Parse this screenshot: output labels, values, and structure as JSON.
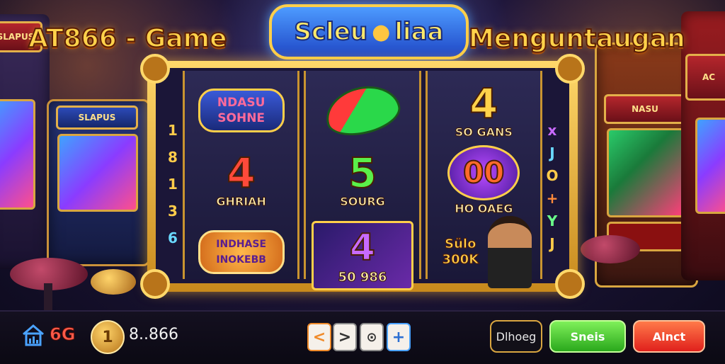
{
  "title": {
    "left": "AT866 - Game",
    "logo_left": "Scleu",
    "logo_right": "liaa",
    "right": "Menguntaugan"
  },
  "side_left_numbers": [
    "1",
    "8",
    "1",
    "3",
    "6"
  ],
  "side_right_symbols": [
    "x",
    "J",
    "O",
    "+",
    "Y",
    "J"
  ],
  "reels": [
    [
      {
        "plate": "NDASU SOHNE"
      },
      {
        "big": "4",
        "label": "GHRIAH"
      },
      {
        "plate": "INDHASE INOKEBB"
      }
    ],
    [
      {
        "icon": "watermelon-icon"
      },
      {
        "big": "5",
        "label": "SOURG"
      },
      {
        "big": "4",
        "label": "50 986"
      }
    ],
    [
      {
        "big": "4",
        "label": "SO GANS"
      },
      {
        "big": "00",
        "label": "HO OAEG"
      },
      {
        "plate": "Sülo 300K"
      }
    ]
  ],
  "cabinet_marquees": [
    "SLAPUS",
    "NASU",
    "AC"
  ],
  "bottom_bar": {
    "count": "6G",
    "coin_symbol": "1",
    "balance": "8..866",
    "nav": [
      "<",
      ">",
      "⊙",
      "+"
    ],
    "action_dark": "Dlhoeg",
    "action_green": "Sneis",
    "action_red": "Alnct"
  },
  "colors": {
    "gold": "#ffd24a",
    "green": "#2aa81c",
    "red": "#e0201c",
    "blue": "#1f47c6"
  }
}
